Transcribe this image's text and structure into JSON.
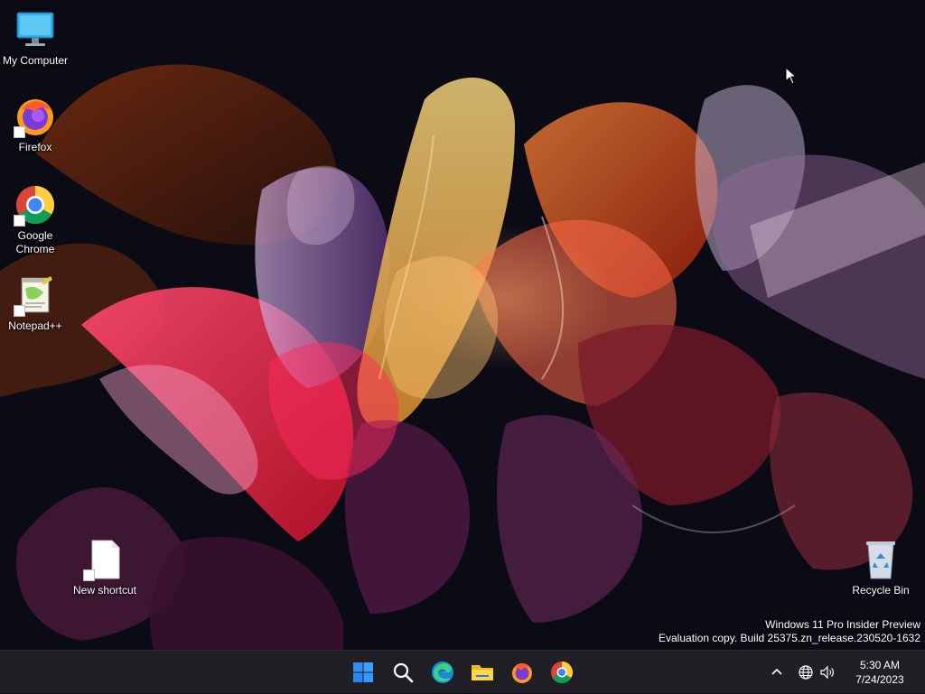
{
  "desktop": {
    "icons": [
      {
        "label": "My Computer",
        "icon": "computer-icon",
        "shortcut": false
      },
      {
        "label": "Firefox",
        "icon": "firefox-icon",
        "shortcut": true
      },
      {
        "label": "Google Chrome",
        "icon": "chrome-icon",
        "shortcut": true
      },
      {
        "label": "Notepad++",
        "icon": "notepad-plus-plus-icon",
        "shortcut": true
      },
      {
        "label": "New shortcut",
        "icon": "blank-file-icon",
        "shortcut": true
      },
      {
        "label": "Recycle Bin",
        "icon": "recycle-bin-icon",
        "shortcut": false
      }
    ],
    "watermark": {
      "line1": "Windows 11 Pro Insider Preview",
      "line2": "Evaluation copy. Build 25375.zn_release.230520-1632"
    }
  },
  "taskbar": {
    "pinned": [
      {
        "name": "Start",
        "icon": "windows-start-icon"
      },
      {
        "name": "Search",
        "icon": "search-icon"
      },
      {
        "name": "Microsoft Edge",
        "icon": "edge-icon"
      },
      {
        "name": "File Explorer",
        "icon": "folder-icon"
      },
      {
        "name": "Firefox",
        "icon": "firefox-icon"
      },
      {
        "name": "Google Chrome",
        "icon": "chrome-icon"
      }
    ],
    "tray": {
      "icons": [
        "chevron-up-icon",
        "network-globe-icon",
        "volume-icon"
      ],
      "time": "5:30 AM",
      "date": "7/24/2023"
    }
  },
  "colors": {
    "taskbar_bg": "#1f1f25",
    "desktop_bg": "#0b0b15",
    "accent_start": "#2f8ff5"
  }
}
